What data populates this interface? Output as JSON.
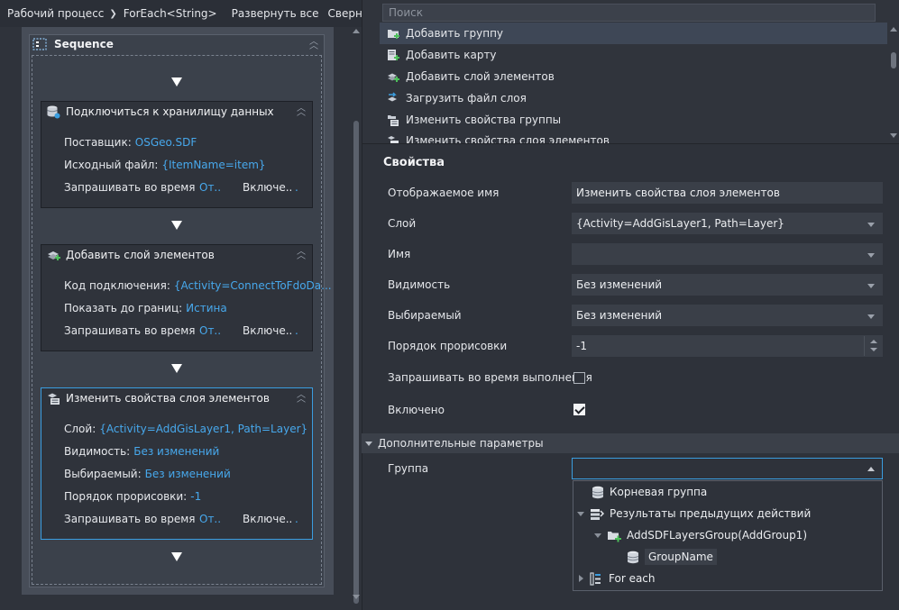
{
  "breadcrumb": {
    "root": "Рабочий процесс",
    "current": "ForEach<String>",
    "expand_all": "Развернуть все",
    "collapse_all": "Свернуть все"
  },
  "sequence": {
    "title": "Sequence"
  },
  "activities": [
    {
      "title": "Подключиться к хранилищу данных",
      "rows": [
        {
          "label": "Поставщик:",
          "value": "OSGeo.SDF"
        },
        {
          "label": "Исходный файл:",
          "value": "{ItemName=item}"
        }
      ],
      "runtime": {
        "label": "Запрашивать во время в...",
        "value": "От...",
        "label2": "Включе...",
        "dot": "."
      }
    },
    {
      "title": "Добавить слой элементов",
      "rows": [
        {
          "label": "Код подключения:",
          "value": "{Activity=ConnectToFdoDa..."
        },
        {
          "label": "Показать до границ:",
          "value": "Истина"
        }
      ],
      "runtime": {
        "label": "Запрашивать во время в...",
        "value": "От...",
        "label2": "Включе...",
        "dot": "."
      }
    },
    {
      "title": "Изменить свойства слоя элементов",
      "rows": [
        {
          "label": "Слой:",
          "value": "{Activity=AddGisLayer1, Path=Layer}"
        },
        {
          "label": "Видимость:",
          "value": "Без изменений"
        },
        {
          "label": "Выбираемый:",
          "value": "Без изменений"
        },
        {
          "label": "Порядок прорисовки:",
          "value": "-1"
        }
      ],
      "runtime": {
        "label": "Запрашивать во время в...",
        "value": "От...",
        "label2": "Включе...",
        "dot": "."
      }
    }
  ],
  "toolbox": {
    "search_placeholder": "Поиск",
    "items": [
      {
        "label": "Добавить группу",
        "icon": "add-group-icon"
      },
      {
        "label": "Добавить карту",
        "icon": "add-map-icon"
      },
      {
        "label": "Добавить слой элементов",
        "icon": "add-layer-icon"
      },
      {
        "label": "Загрузить файл слоя",
        "icon": "load-layer-file-icon"
      },
      {
        "label": "Изменить свойства группы",
        "icon": "group-properties-icon"
      },
      {
        "label": "Изменить свойства слоя элементов",
        "icon": "layer-properties-icon"
      }
    ]
  },
  "properties": {
    "title": "Свойства",
    "display_name": {
      "label": "Отображаемое имя",
      "value": "Изменить свойства слоя элементов"
    },
    "layer": {
      "label": "Слой",
      "value": "{Activity=AddGisLayer1, Path=Layer}"
    },
    "name": {
      "label": "Имя",
      "value": ""
    },
    "visibility": {
      "label": "Видимость",
      "value": "Без изменений"
    },
    "selectable": {
      "label": "Выбираемый",
      "value": "Без изменений"
    },
    "draw_order": {
      "label": "Порядок прорисовки",
      "value": "-1"
    },
    "prompt_runtime": {
      "label": "Запрашивать во время выполнения",
      "checked": false
    },
    "enabled": {
      "label": "Включено",
      "checked": true
    },
    "advanced": {
      "label": "Дополнительные параметры"
    },
    "group": {
      "label": "Группа",
      "value": ""
    },
    "group_options": [
      {
        "label": "Корневая группа",
        "icon": "database-icon"
      },
      {
        "label": "Результаты предыдущих действий",
        "icon": "activity-results-icon"
      },
      {
        "label": "AddSDFLayersGroup(AddGroup1)",
        "icon": "add-group-icon"
      },
      {
        "label": "GroupName",
        "icon": "database-icon"
      },
      {
        "label": "For each",
        "icon": "foreach-icon"
      }
    ]
  },
  "colors": {
    "accent": "#3a9ddf",
    "link_value": "#47a8ec",
    "background": "#2b2f37"
  }
}
